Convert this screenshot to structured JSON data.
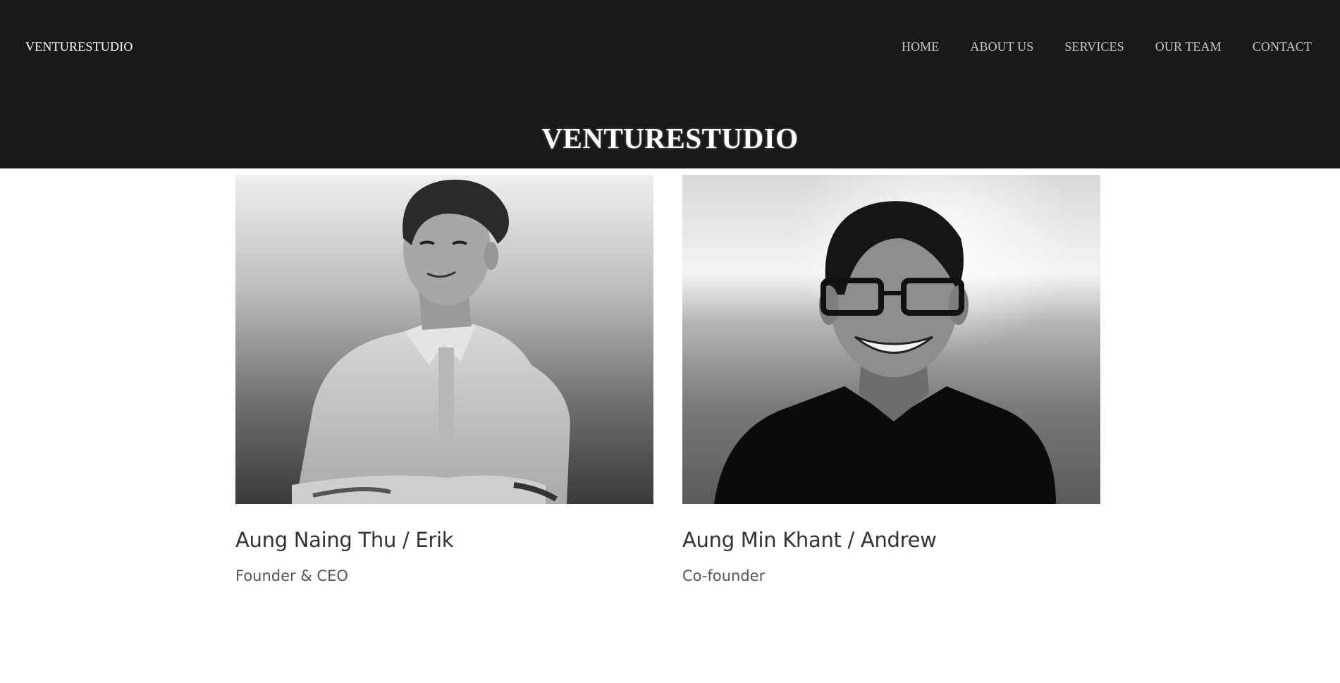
{
  "brand": "VENTURESTUDIO",
  "nav": [
    {
      "label": "HOME"
    },
    {
      "label": "ABOUT US"
    },
    {
      "label": "SERVICES"
    },
    {
      "label": "OUR TEAM"
    },
    {
      "label": "CONTACT"
    }
  ],
  "hero": {
    "title": "VENTURESTUDIO"
  },
  "team": [
    {
      "name": "Aung Naing Thu / Erik",
      "role": "Founder & CEO"
    },
    {
      "name": "Aung Min Khant / Andrew",
      "role": "Co-founder"
    }
  ],
  "colors": {
    "header_bg": "#191919",
    "nav_text": "#c9c9c9",
    "name_text": "#333333",
    "role_text": "#555555"
  }
}
